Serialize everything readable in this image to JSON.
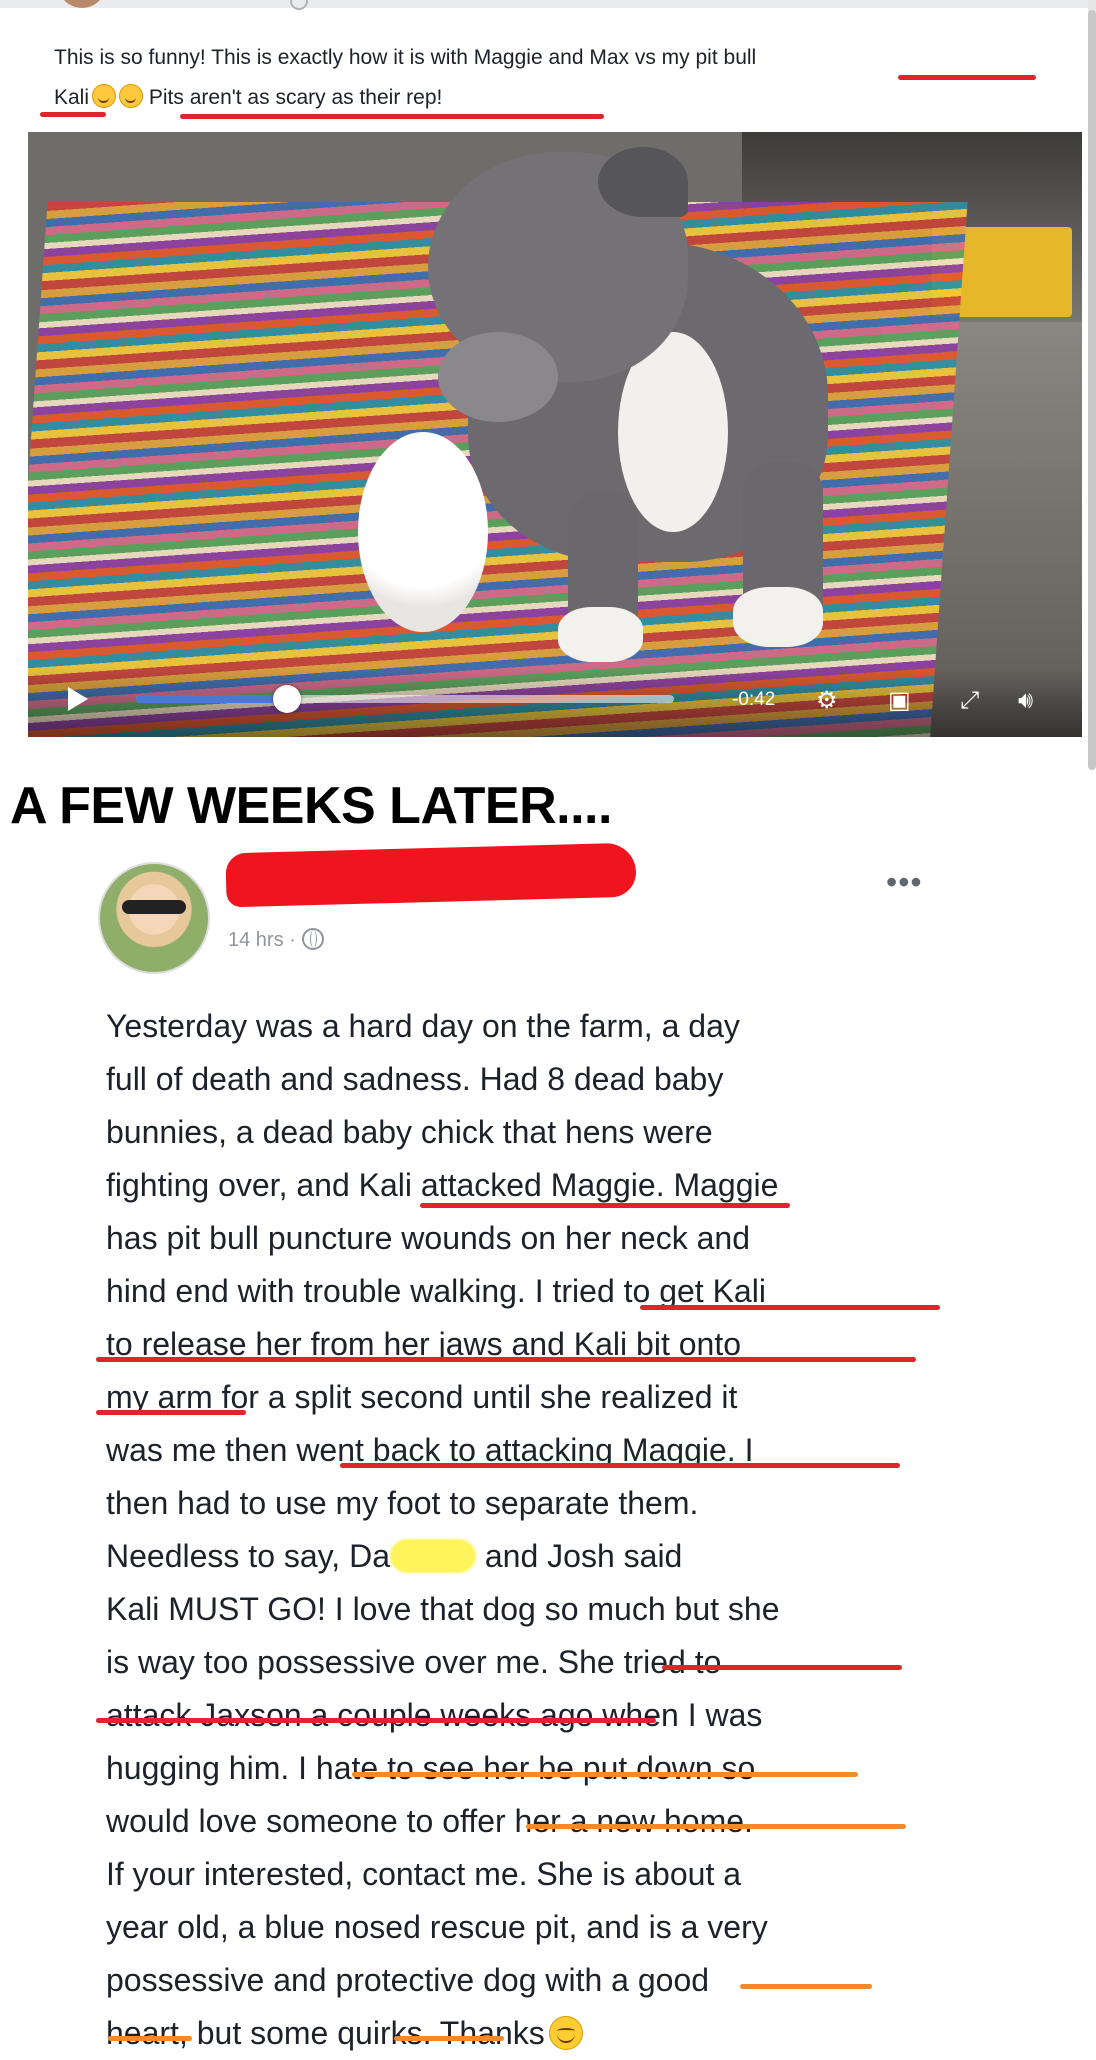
{
  "post1": {
    "lines": [
      "This is so funny! This is exactly how it is with Maggie and Max vs my pit bull",
      "Kali",
      "Pits aren't as scary as their rep!"
    ]
  },
  "video": {
    "time_remaining": "-0:42",
    "progress_fraction": 0.28,
    "icons": [
      "play-icon",
      "gear-icon",
      "share-icon",
      "expand-icon",
      "volume-icon"
    ]
  },
  "headline": "A FEW WEEKS LATER....",
  "post2": {
    "timestamp": "14 hrs",
    "separator": "·",
    "more": "•••",
    "lines": [
      "Yesterday was a hard day on the farm, a day",
      "full of death and sadness. Had 8 dead baby",
      "bunnies, a dead baby chick that hens were",
      "fighting over, and Kali attacked Maggie. Maggie",
      "has pit bull puncture wounds on her neck and",
      "hind end with trouble walking. I tried to get Kali",
      "to release her from her jaws and Kali bit onto",
      "my arm for a split second until she realized it",
      "was me then went back to attacking Maggie. I",
      "then had to use my foot to separate them.",
      "Needless to say, Da",
      "and Josh said",
      "Kali MUST GO! I love that dog so much but she",
      "is way too possessive over me. She tried to",
      "attack Jaxson a couple weeks ago when I was",
      "hugging him. I hate to see her be put down so",
      "would love someone to offer her a new home.",
      "If your interested, contact me. She is about a",
      "year old, a blue nosed rescue pit, and is a very",
      "possessive and protective dog with a good",
      "heart, but some quirks. Thanks"
    ]
  },
  "colors": {
    "underline_red": "#e0242c",
    "underline_orange": "#f08a2a",
    "redaction_red": "#f0141f",
    "redaction_yellow": "#fff45c",
    "progress_blue": "#4a78d8"
  }
}
